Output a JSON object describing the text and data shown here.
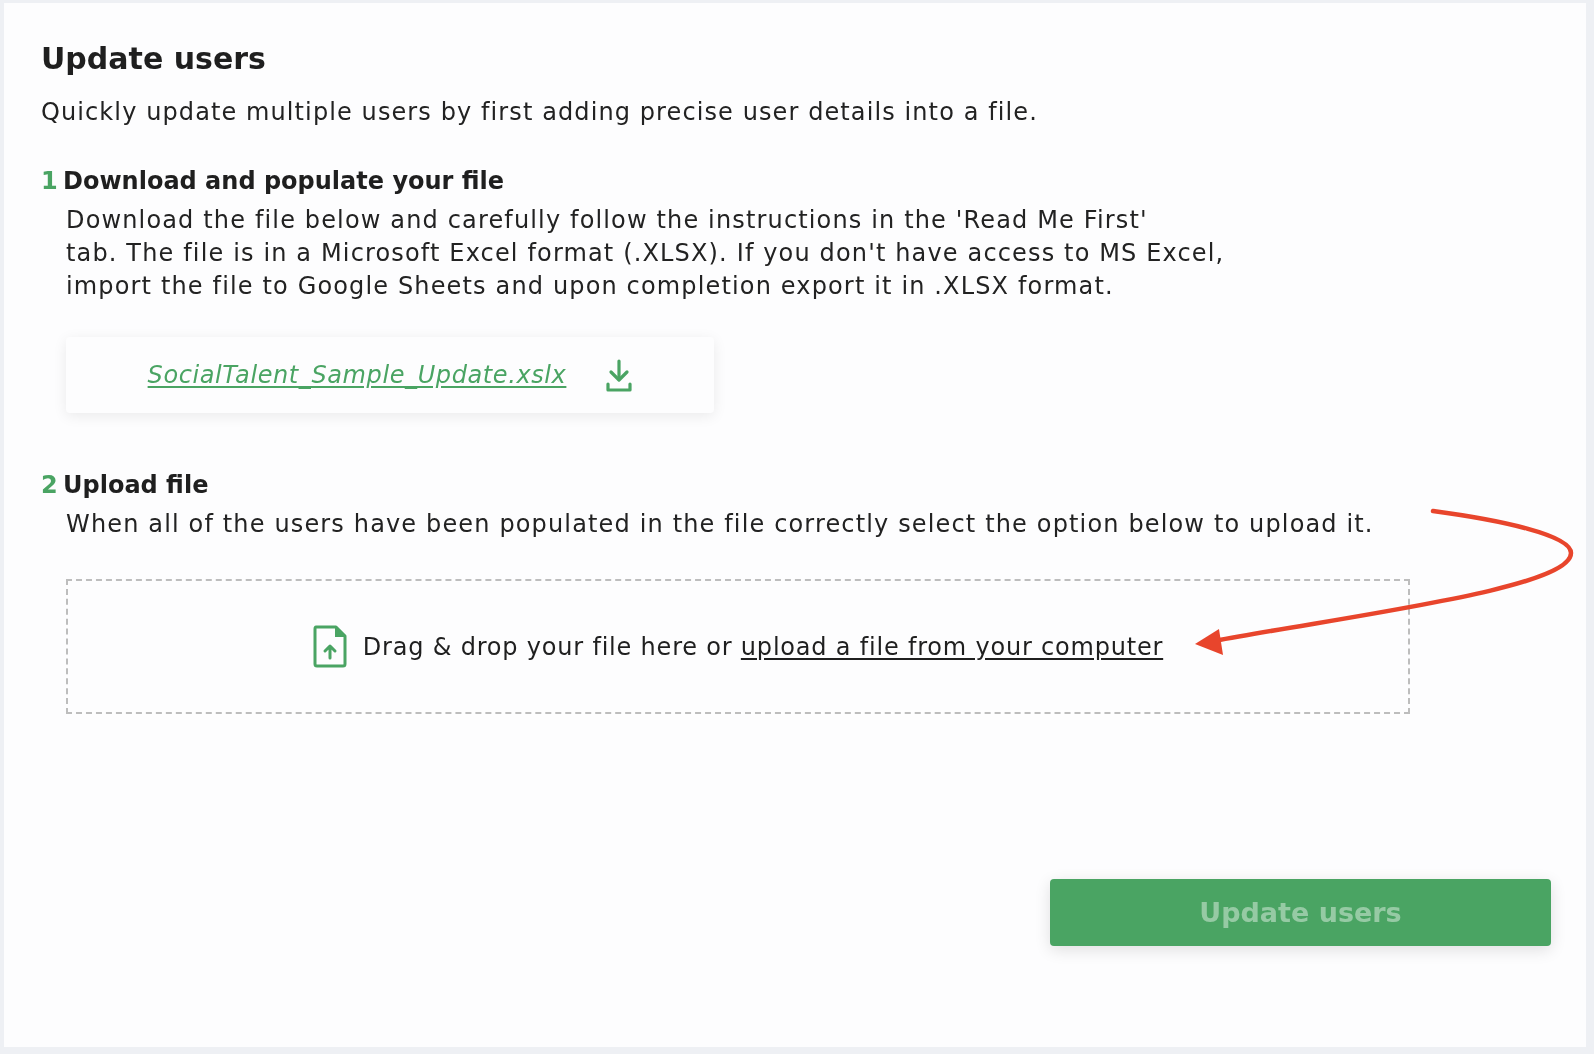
{
  "title": "Update users",
  "subtitle": "Quickly update multiple users by first adding precise user details into a file.",
  "steps": [
    {
      "kind": "download",
      "number": "1",
      "heading": "Download and populate your file",
      "description_lines": [
        "Download the file below and carefully follow the instructions in the 'Read Me First'",
        "tab. The file is in a Microsoft Excel format (.XLSX). If you don't have access to MS Excel,",
        "import the file to Google Sheets and upon completion export it in .XLSX format."
      ],
      "file_link": "SocialTalent_Sample_Update.xslx"
    },
    {
      "kind": "upload",
      "number": "2",
      "heading": "Upload file",
      "description_lines": [
        "When all of the users have been populated in the file correctly select the option below to upload it."
      ],
      "dropzone_text": "Drag & drop your file here or",
      "dropzone_link": "upload a file from your computer"
    }
  ],
  "submit_button": {
    "label": "Update users",
    "disabled": true
  }
}
